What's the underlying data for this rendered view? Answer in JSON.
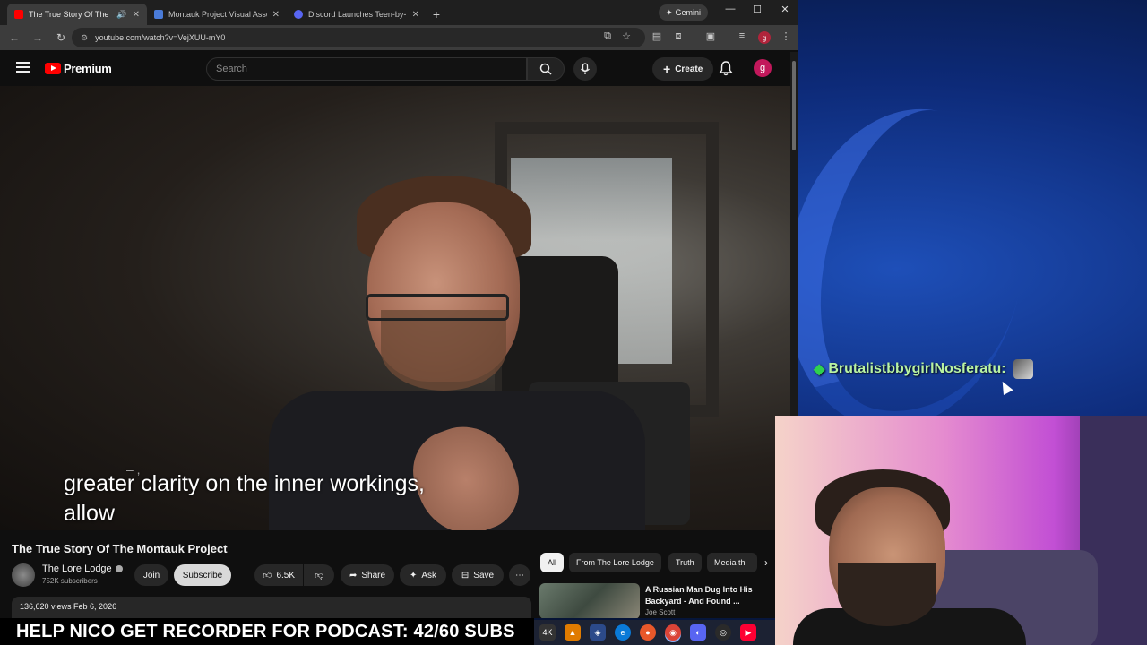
{
  "browser": {
    "tabs": [
      {
        "title": "The True Story Of The Montauk",
        "favicon_color": "#ff0000",
        "active": true
      },
      {
        "title": "Montauk Project Visual Assets",
        "favicon_color": "#4a7bd8",
        "active": false
      },
      {
        "title": "Discord Launches Teen-by-Defa",
        "favicon_color": "#5865f2",
        "active": false
      }
    ],
    "gemini_label": "Gemini",
    "url": "youtube.com/watch?v=VejXUU-mY0",
    "profile_initial": "g"
  },
  "youtube": {
    "logo_text": "Premium",
    "search_placeholder": "Search",
    "create_label": "Create",
    "avatar_initial": "g",
    "caption_ghost": "–   ,",
    "caption_line1": "greater clarity on the inner workings,",
    "caption_line2": "allow",
    "video_title": "The True Story Of The Montauk Project",
    "channel_name": "The Lore Lodge",
    "subscribers": "752K subscribers",
    "join_label": "Join",
    "subscribe_label": "Subscribe",
    "likes": "6.5K",
    "share_label": "Share",
    "ask_label": "Ask",
    "save_label": "Save",
    "views_date": "136,620 views  Feb 6, 2026",
    "chips": [
      "All",
      "From The Lore Lodge",
      "Truth",
      "Media th"
    ],
    "recommendation": {
      "title": "A Russian Man Dug Into His Backyard - And Found ...",
      "channel": "Joe Scott"
    }
  },
  "stream": {
    "chat_user": "BrutalistbbygirlNosferatu:",
    "banner": "HELP NICO GET RECORDER FOR PODCAST: 42/60 SUBS"
  },
  "taskbar_icons": [
    "4K",
    "VLC",
    "Shield",
    "Edge",
    "Firefox",
    "Chrome",
    "Discord",
    "OBS",
    "YT"
  ]
}
